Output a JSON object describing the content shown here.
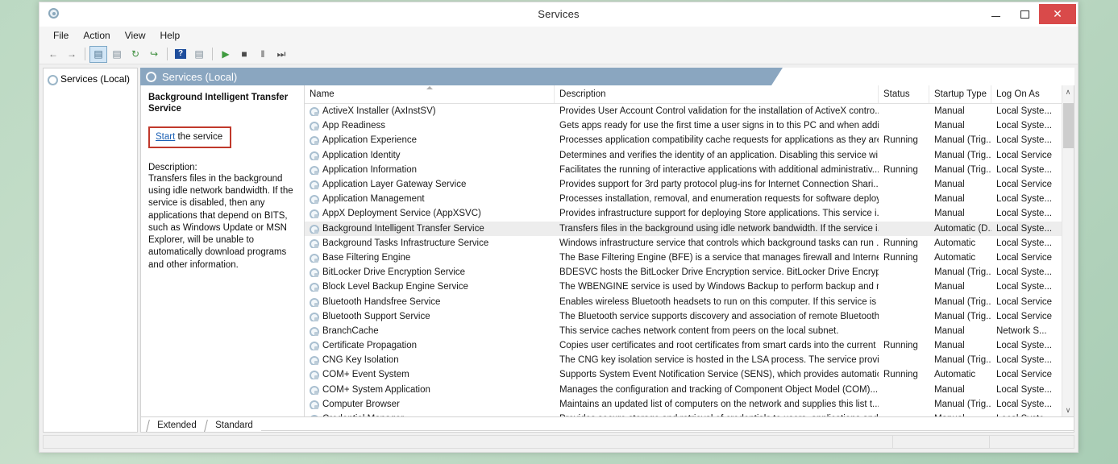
{
  "window": {
    "title": "Services",
    "icon": "services-gear-icon",
    "minimize_label": "—",
    "maximize_label": "❐",
    "close_label": "✕"
  },
  "menubar": {
    "items": [
      {
        "label": "File"
      },
      {
        "label": "Action"
      },
      {
        "label": "View"
      },
      {
        "label": "Help"
      }
    ]
  },
  "toolbar": {
    "buttons": [
      {
        "name": "back-arrow-icon",
        "glyph": "←",
        "color": "#6e6e6e",
        "active": false
      },
      {
        "name": "forward-arrow-icon",
        "glyph": "→",
        "color": "#6e6e6e",
        "active": false
      },
      {
        "name": "show-hide-tree-icon",
        "glyph": "▤",
        "color": "#4a6f8a",
        "active": true
      },
      {
        "name": "properties-icon",
        "glyph": "▤",
        "color": "#7a8a95",
        "active": false
      },
      {
        "name": "refresh-icon",
        "glyph": "↻",
        "color": "#3f8f3f",
        "active": false
      },
      {
        "name": "export-list-icon",
        "glyph": "↪",
        "color": "#3f8f3f",
        "active": false
      },
      {
        "name": "help-icon",
        "glyph": "?",
        "color": "#ffffff",
        "active": false
      },
      {
        "name": "show-details-icon",
        "glyph": "▤",
        "color": "#7a8a95",
        "active": false
      },
      {
        "name": "start-service-icon",
        "glyph": "▶",
        "color": "#3f9b3f",
        "active": false
      },
      {
        "name": "stop-service-icon",
        "glyph": "■",
        "color": "#4a4a4a",
        "active": false
      },
      {
        "name": "pause-service-icon",
        "glyph": "‖",
        "color": "#4a4a4a",
        "active": false
      },
      {
        "name": "restart-service-icon",
        "glyph": "⏭",
        "color": "#4a4a4a",
        "active": false
      }
    ]
  },
  "tree": {
    "root_label": "Services (Local)"
  },
  "console": {
    "header_label": "Services (Local)"
  },
  "detail": {
    "service_title": "Background Intelligent Transfer Service",
    "action_link": "Start",
    "action_suffix": " the service",
    "description_label": "Description:",
    "description_text": "Transfers files in the background using idle network bandwidth. If the service is disabled, then any applications that depend on BITS, such as Windows Update or MSN Explorer, will be unable to automatically download programs and other information.",
    "highlight_color": "#c0392b",
    "link_color": "#1a5fb4"
  },
  "list": {
    "columns": [
      {
        "key": "name",
        "label": "Name",
        "sorted": "asc"
      },
      {
        "key": "desc",
        "label": "Description",
        "sorted": ""
      },
      {
        "key": "status",
        "label": "Status",
        "sorted": ""
      },
      {
        "key": "startup",
        "label": "Startup Type",
        "sorted": ""
      },
      {
        "key": "logon",
        "label": "Log On As",
        "sorted": ""
      }
    ],
    "rows": [
      {
        "name": "ActiveX Installer (AxInstSV)",
        "desc": "Provides User Account Control validation for the installation of ActiveX contro...",
        "status": "",
        "startup": "Manual",
        "logon": "Local Syste...",
        "selected": false
      },
      {
        "name": "App Readiness",
        "desc": "Gets apps ready for use the first time a user signs in to this PC and when addin...",
        "status": "",
        "startup": "Manual",
        "logon": "Local Syste...",
        "selected": false
      },
      {
        "name": "Application Experience",
        "desc": "Processes application compatibility cache requests for applications as they are...",
        "status": "Running",
        "startup": "Manual (Trig...",
        "logon": "Local Syste...",
        "selected": false
      },
      {
        "name": "Application Identity",
        "desc": "Determines and verifies the identity of an application. Disabling this service wi...",
        "status": "",
        "startup": "Manual (Trig...",
        "logon": "Local Service",
        "selected": false
      },
      {
        "name": "Application Information",
        "desc": "Facilitates the running of interactive applications with additional administrativ...",
        "status": "Running",
        "startup": "Manual (Trig...",
        "logon": "Local Syste...",
        "selected": false
      },
      {
        "name": "Application Layer Gateway Service",
        "desc": "Provides support for 3rd party protocol plug-ins for Internet Connection Shari...",
        "status": "",
        "startup": "Manual",
        "logon": "Local Service",
        "selected": false
      },
      {
        "name": "Application Management",
        "desc": "Processes installation, removal, and enumeration requests for software deploy...",
        "status": "",
        "startup": "Manual",
        "logon": "Local Syste...",
        "selected": false
      },
      {
        "name": "AppX Deployment Service (AppXSVC)",
        "desc": "Provides infrastructure support for deploying Store applications. This service i...",
        "status": "",
        "startup": "Manual",
        "logon": "Local Syste...",
        "selected": false
      },
      {
        "name": "Background Intelligent Transfer Service",
        "desc": "Transfers files in the background using idle network bandwidth. If the service i...",
        "status": "",
        "startup": "Automatic (D...",
        "logon": "Local Syste...",
        "selected": true
      },
      {
        "name": "Background Tasks Infrastructure Service",
        "desc": "Windows infrastructure service that controls which background tasks can run ...",
        "status": "Running",
        "startup": "Automatic",
        "logon": "Local Syste...",
        "selected": false
      },
      {
        "name": "Base Filtering Engine",
        "desc": "The Base Filtering Engine (BFE) is a service that manages firewall and Internet ...",
        "status": "Running",
        "startup": "Automatic",
        "logon": "Local Service",
        "selected": false
      },
      {
        "name": "BitLocker Drive Encryption Service",
        "desc": "BDESVC hosts the BitLocker Drive Encryption service. BitLocker Drive Encrypti...",
        "status": "",
        "startup": "Manual (Trig...",
        "logon": "Local Syste...",
        "selected": false
      },
      {
        "name": "Block Level Backup Engine Service",
        "desc": "The WBENGINE service is used by Windows Backup to perform backup and re...",
        "status": "",
        "startup": "Manual",
        "logon": "Local Syste...",
        "selected": false
      },
      {
        "name": "Bluetooth Handsfree Service",
        "desc": "Enables wireless Bluetooth headsets to run on this computer. If this service is s...",
        "status": "",
        "startup": "Manual (Trig...",
        "logon": "Local Service",
        "selected": false
      },
      {
        "name": "Bluetooth Support Service",
        "desc": "The Bluetooth service supports discovery and association of remote Bluetooth...",
        "status": "",
        "startup": "Manual (Trig...",
        "logon": "Local Service",
        "selected": false
      },
      {
        "name": "BranchCache",
        "desc": "This service caches network content from peers on the local subnet.",
        "status": "",
        "startup": "Manual",
        "logon": "Network S...",
        "selected": false
      },
      {
        "name": "Certificate Propagation",
        "desc": "Copies user certificates and root certificates from smart cards into the current ...",
        "status": "Running",
        "startup": "Manual",
        "logon": "Local Syste...",
        "selected": false
      },
      {
        "name": "CNG Key Isolation",
        "desc": "The CNG key isolation service is hosted in the LSA process. The service provid...",
        "status": "",
        "startup": "Manual (Trig...",
        "logon": "Local Syste...",
        "selected": false
      },
      {
        "name": "COM+ Event System",
        "desc": "Supports System Event Notification Service (SENS), which provides automatic ...",
        "status": "Running",
        "startup": "Automatic",
        "logon": "Local Service",
        "selected": false
      },
      {
        "name": "COM+ System Application",
        "desc": "Manages the configuration and tracking of Component Object Model (COM)...",
        "status": "",
        "startup": "Manual",
        "logon": "Local Syste...",
        "selected": false
      },
      {
        "name": "Computer Browser",
        "desc": "Maintains an updated list of computers on the network and supplies this list t...",
        "status": "",
        "startup": "Manual (Trig...",
        "logon": "Local Syste...",
        "selected": false
      },
      {
        "name": "Credential Manager",
        "desc": "Provides secure storage and retrieval of credentials to users, applications and s...",
        "status": "",
        "startup": "Manual",
        "logon": "Local Syste...",
        "selected": false
      }
    ]
  },
  "scrollbar": {
    "up_glyph": "∧",
    "down_glyph": "∨"
  },
  "tabs": [
    {
      "label": "Extended",
      "active": false
    },
    {
      "label": "Standard",
      "active": true
    }
  ],
  "statusbar": {
    "main": "",
    "panel_b": "",
    "panel_c": ""
  }
}
